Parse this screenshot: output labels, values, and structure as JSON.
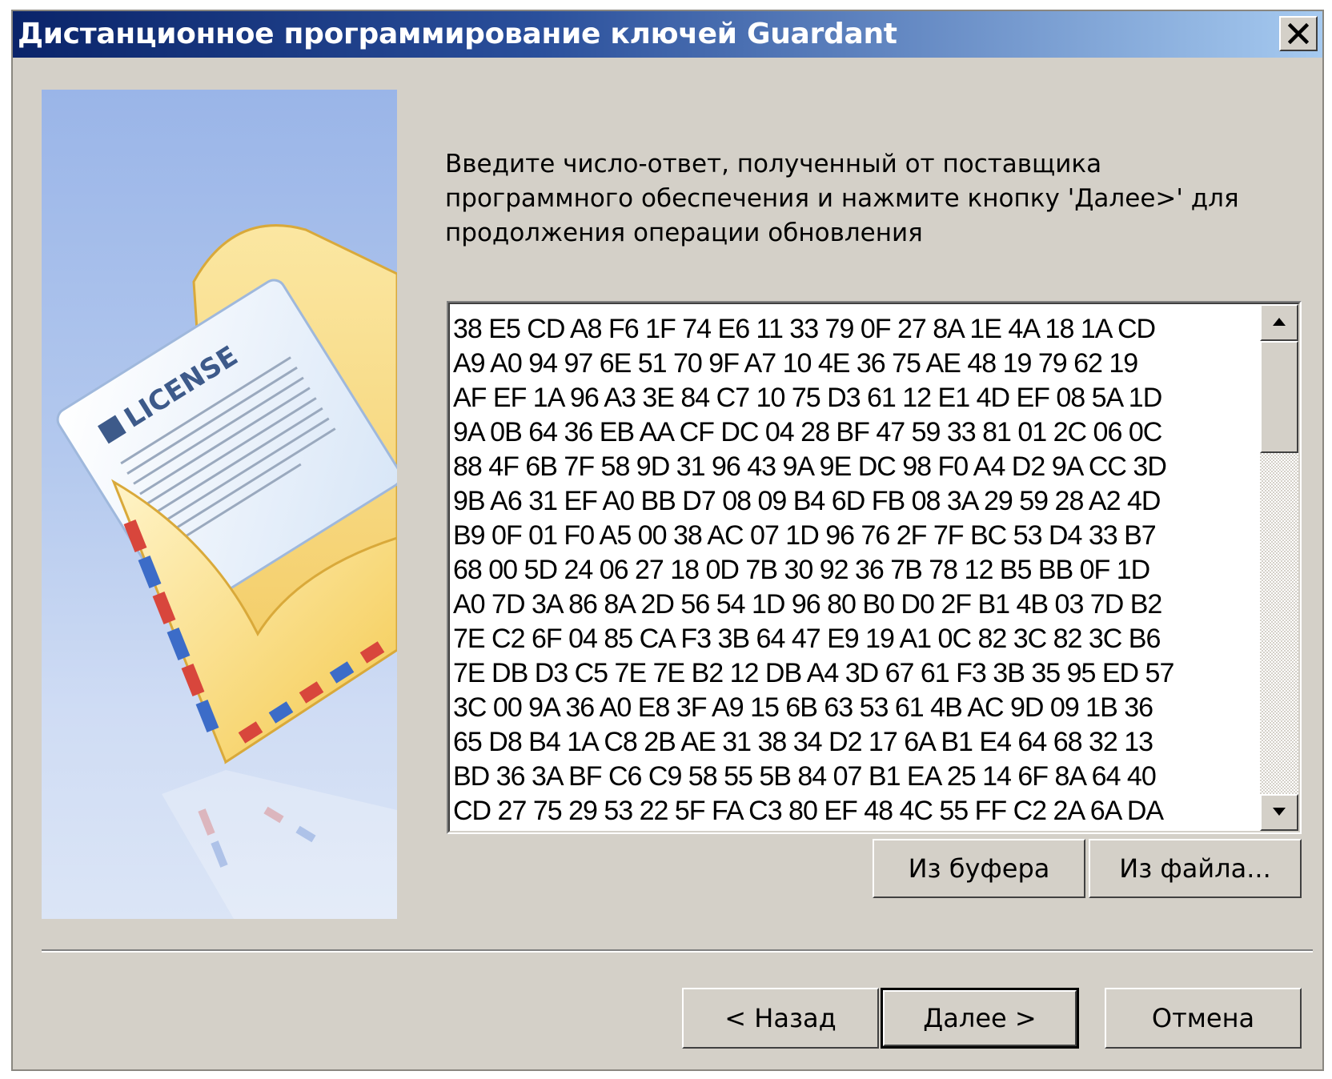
{
  "window": {
    "title": "Дистанционное программирование ключей Guardant"
  },
  "side_image": {
    "license_label": "LICENSE",
    "icon": "license-envelope-illustration"
  },
  "instruction": {
    "text": "Введите число-ответ, полученный от поставщика\nпрограммного обеспечения и нажмите кнопку 'Далее>' для\nпродолжения операции обновления"
  },
  "response_field": {
    "lines": [
      "38 E5 CD A8 F6 1F 74 E6 11 33 79 0F 27 8A 1E 4A 18 1A CD",
      "A9 A0 94 97 6E 51 70 9F A7 10 4E 36 75 AE 48 19 79 62 19",
      "AF EF 1A 96 A3 3E 84 C7 10 75 D3 61 12 E1 4D EF 08 5A 1D",
      "9A 0B 64 36 EB AA CF DC 04 28 BF 47 59 33 81 01 2C 06 0C",
      "88 4F 6B 7F 58 9D 31 96 43 9A 9E DC 98 F0 A4 D2 9A CC 3D",
      "9B A6 31 EF A0 BB D7 08 09 B4 6D FB 08 3A 29 59 28 A2 4D",
      "B9 0F 01 F0 A5 00 38 AC 07 1D 96 76 2F 7F BC 53 D4 33 B7",
      "68 00 5D 24 06 27 18 0D 7B 30 92 36 7B 78 12 B5 BB 0F 1D",
      "A0 7D 3A 86 8A 2D 56 54 1D 96 80 B0 D0 2F B1 4B 03 7D B2",
      "7E C2 6F 04 85 CA F3 3B 64 47 E9 19 A1 0C 82 3C 82 3C B6",
      "7E DB D3 C5 7E 7E B2 12 DB A4 3D 67 61 F3 3B 35 95 ED 57",
      "3C 00 9A 36 A0 E8 3F A9 15 6B 63 53 61 4B AC 9D 09 1B 36",
      "65 D8 B4 1A C8 2B AE 31 38 34 D2 17 6A B1 E4 64 68 32 13",
      "BD 36 3A BF C6 C9 58 55 5B 84 07 B1 EA 25 14 6F 8A 64 40",
      "CD 27 75 29 53 22 5F FA C3 80 EF 48 4C 55 FF C2 2A 6A DA"
    ]
  },
  "buttons": {
    "from_clipboard": "Из буфера",
    "from_file": "Из файла...",
    "back": "< Назад",
    "next": "Далее >",
    "cancel": "Отмена"
  }
}
